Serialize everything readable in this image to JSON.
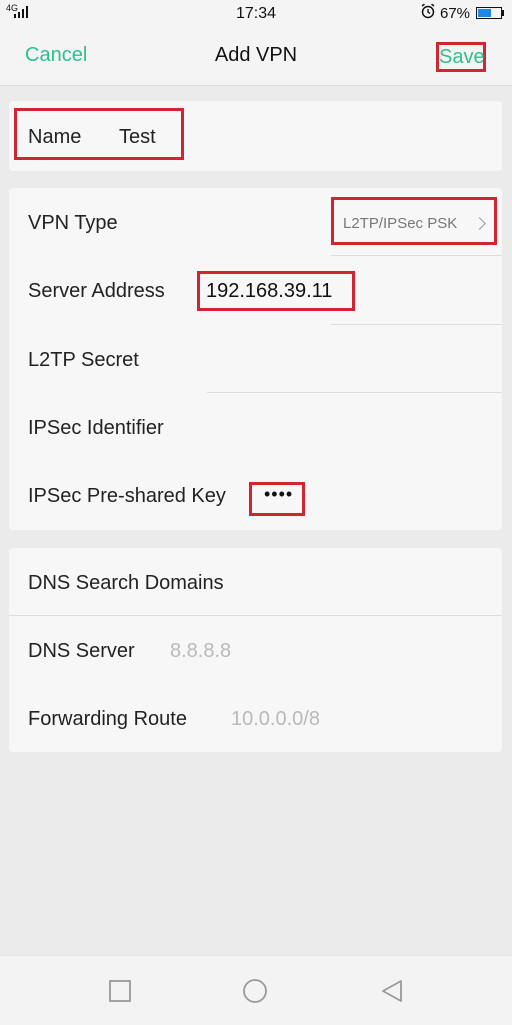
{
  "status_bar": {
    "network": "4G",
    "time": "17:34",
    "alarm_icon": "alarm-clock-icon",
    "battery_percent": "67%",
    "battery_level": 0.67
  },
  "header": {
    "cancel_label": "Cancel",
    "title": "Add VPN",
    "save_label": "Save"
  },
  "name_section": {
    "label": "Name",
    "value": "Test"
  },
  "vpn_section": {
    "vpn_type": {
      "label": "VPN Type",
      "value": "L2TP/IPSec PSK"
    },
    "server_address": {
      "label": "Server Address",
      "value": "192.168.39.11"
    },
    "l2tp_secret": {
      "label": "L2TP Secret",
      "value": ""
    },
    "ipsec_identifier": {
      "label": "IPSec Identifier",
      "value": ""
    },
    "ipsec_psk": {
      "label": "IPSec Pre-shared Key",
      "value": "••••"
    }
  },
  "dns_section": {
    "dns_search": {
      "label": "DNS Search Domains",
      "value": ""
    },
    "dns_server": {
      "label": "DNS Server",
      "placeholder": "8.8.8.8"
    },
    "forwarding_route": {
      "label": "Forwarding Route",
      "placeholder": "10.0.0.0/8"
    }
  },
  "navigation": {
    "recents_icon": "square-icon",
    "home_icon": "circle-icon",
    "back_icon": "triangle-back-icon"
  },
  "colors": {
    "accent": "#2fbf8d",
    "highlight": "#d0262f",
    "battery": "#1e88e5"
  }
}
